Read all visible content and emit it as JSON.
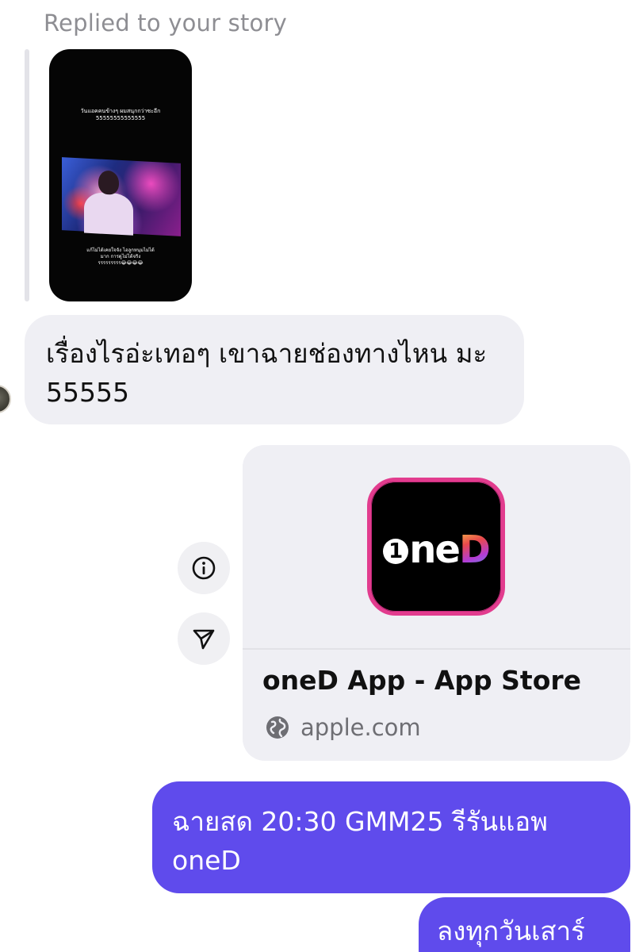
{
  "reply": {
    "caption": "Replied to your story",
    "story": {
      "overlay_text_top": "วันแอคคนข้างๆ ผมสนุกกว่าซะอีก\n55555555555555",
      "overlay_text_bottom": "แก้ไม่ได้เคยใจจัง ไอลูกหนุมไม่ได้\nมาก การดูไม่ได้จริง\nรรรรรรรรร😂😂😂😂"
    }
  },
  "messages": [
    {
      "direction": "incoming",
      "text": "เรื่องไรอ่ะเทอๆ เขาฉายช่องทางไหน มะ 55555"
    },
    {
      "direction": "outgoing",
      "type": "link_preview",
      "app_icon_text": "oneD",
      "title": "oneD App - App Store",
      "domain": "apple.com",
      "actions": {
        "info_icon": "info-icon",
        "share_icon": "send-icon"
      }
    },
    {
      "direction": "outgoing",
      "text": "ฉายสด 20:30 GMM25 รีรันแอพ oneD"
    },
    {
      "direction": "outgoing",
      "text": "ลงทุกวันเสาร์"
    }
  ],
  "colors": {
    "outgoing_bubble": "#5f4bec",
    "incoming_bubble": "#efeff4",
    "caption_text": "#8e8e93",
    "app_icon_border": "#e23c8e"
  }
}
